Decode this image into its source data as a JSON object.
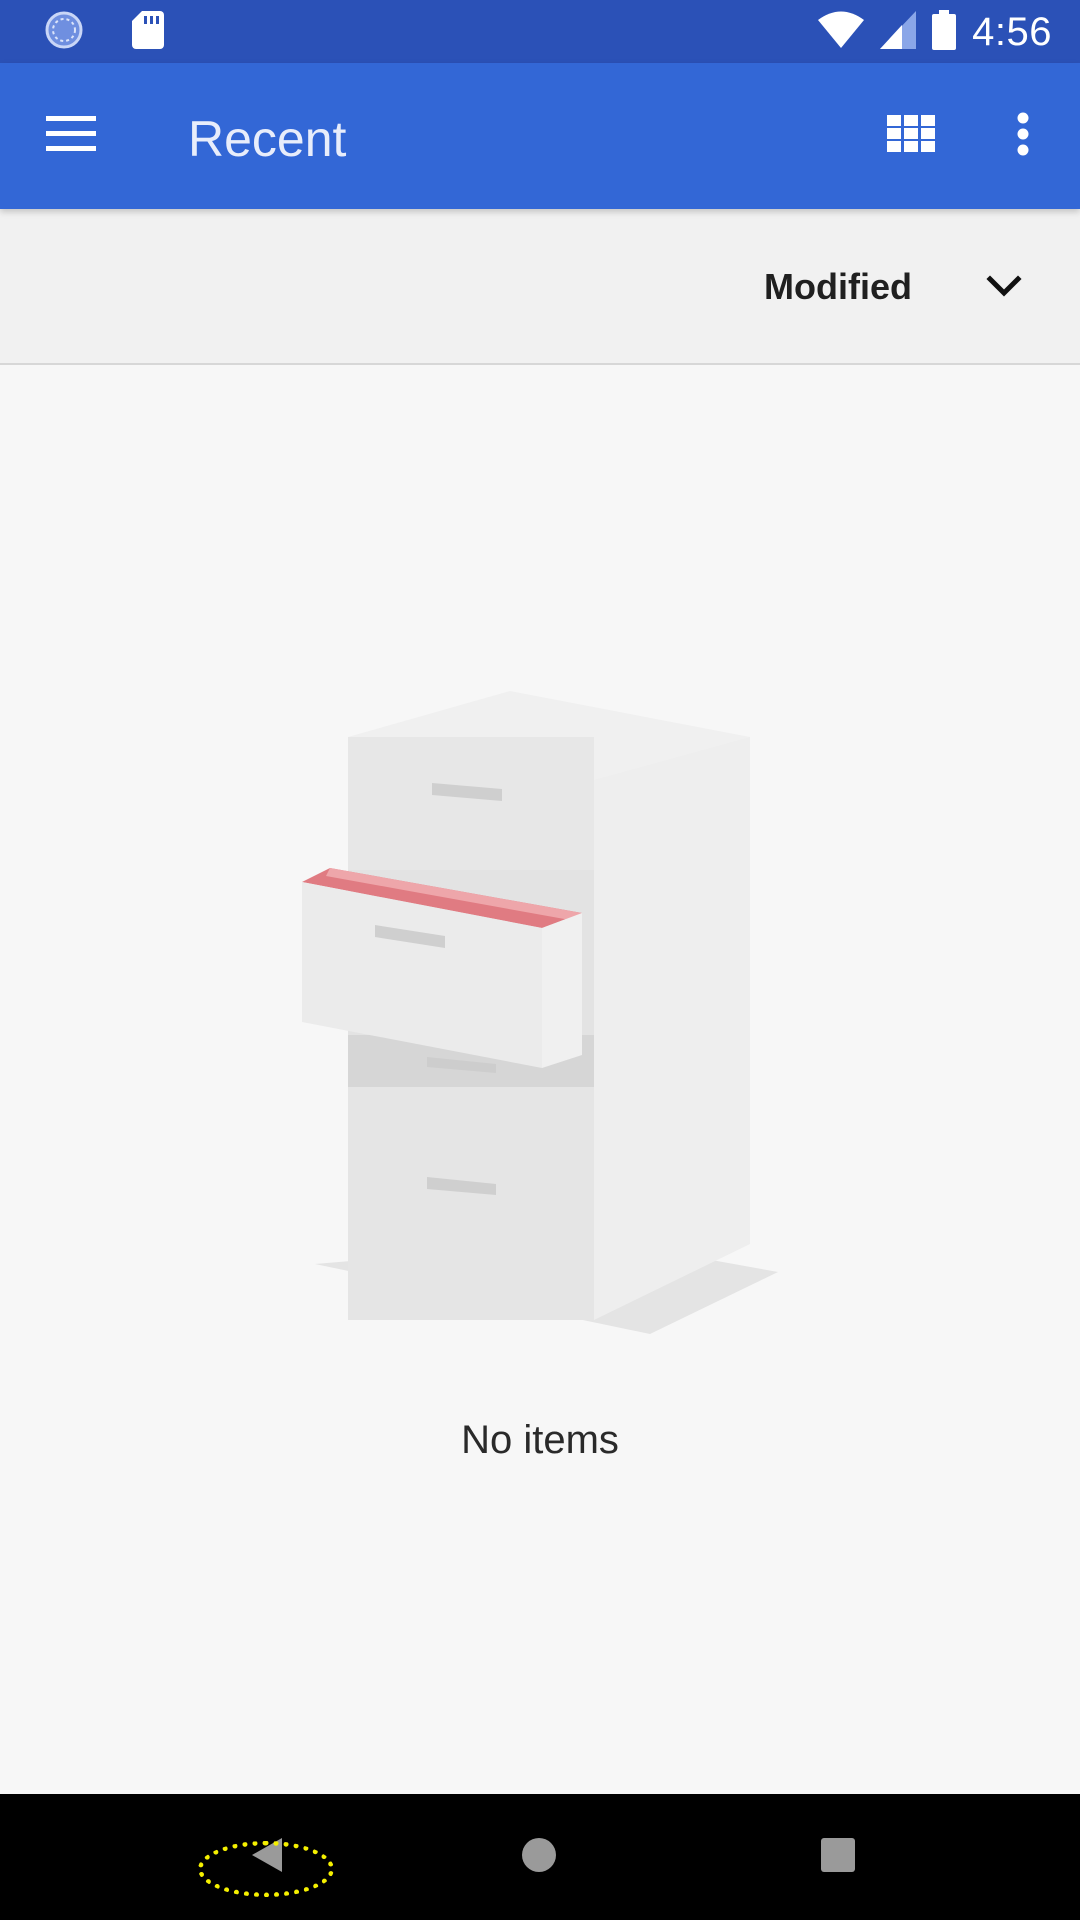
{
  "status_bar": {
    "time": "4:56",
    "icons": [
      "sync-icon",
      "sd-card-icon",
      "wifi-icon",
      "signal-icon",
      "battery-icon"
    ]
  },
  "app_bar": {
    "title": "Recent",
    "menu_icon": "hamburger-menu-icon",
    "grid_icon": "grid-view-icon",
    "more_icon": "more-vert-icon"
  },
  "sort_bar": {
    "label": "Modified",
    "icon": "chevron-down-icon"
  },
  "empty_state": {
    "illustration": "file-cabinet-illustration",
    "message": "No items"
  },
  "nav_bar": {
    "buttons": [
      "back-icon",
      "home-icon",
      "recents-icon"
    ]
  },
  "colors": {
    "status_bar": "#2b51b7",
    "app_bar": "#3367d6",
    "background": "#f7f7f7",
    "sort_bar": "#f1f1f1",
    "highlight": "#f5f000"
  }
}
